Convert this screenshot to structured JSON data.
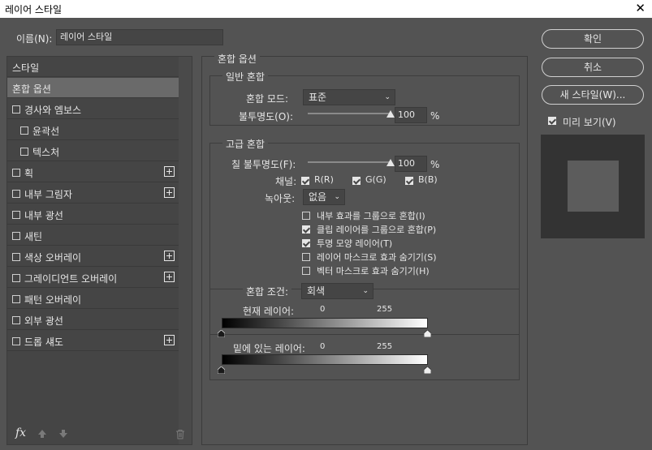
{
  "window": {
    "title": "레이어 스타일",
    "close_label": "✕"
  },
  "name_field": {
    "label": "이름(N):",
    "value": "레이어 스타일"
  },
  "styles_list": [
    {
      "label": "스타일",
      "checkbox": false,
      "checked": false,
      "plus": false,
      "selected": false,
      "indent": false
    },
    {
      "label": "혼합 옵션",
      "checkbox": false,
      "checked": false,
      "plus": false,
      "selected": true,
      "indent": false
    },
    {
      "label": "경사와 엠보스",
      "checkbox": true,
      "checked": false,
      "plus": false,
      "selected": false,
      "indent": false
    },
    {
      "label": "윤곽선",
      "checkbox": true,
      "checked": false,
      "plus": false,
      "selected": false,
      "indent": true
    },
    {
      "label": "텍스처",
      "checkbox": true,
      "checked": false,
      "plus": false,
      "selected": false,
      "indent": true
    },
    {
      "label": "획",
      "checkbox": true,
      "checked": false,
      "plus": true,
      "selected": false,
      "indent": false
    },
    {
      "label": "내부 그림자",
      "checkbox": true,
      "checked": false,
      "plus": true,
      "selected": false,
      "indent": false
    },
    {
      "label": "내부 광선",
      "checkbox": true,
      "checked": false,
      "plus": false,
      "selected": false,
      "indent": false
    },
    {
      "label": "새틴",
      "checkbox": true,
      "checked": false,
      "plus": false,
      "selected": false,
      "indent": false
    },
    {
      "label": "색상 오버레이",
      "checkbox": true,
      "checked": false,
      "plus": true,
      "selected": false,
      "indent": false
    },
    {
      "label": "그레이디언트 오버레이",
      "checkbox": true,
      "checked": false,
      "plus": true,
      "selected": false,
      "indent": false
    },
    {
      "label": "패턴 오버레이",
      "checkbox": true,
      "checked": false,
      "plus": false,
      "selected": false,
      "indent": false
    },
    {
      "label": "외부 광선",
      "checkbox": true,
      "checked": false,
      "plus": false,
      "selected": false,
      "indent": false
    },
    {
      "label": "드롭 섀도",
      "checkbox": true,
      "checked": false,
      "plus": true,
      "selected": false,
      "indent": false
    }
  ],
  "list_footer": {
    "fx_label": "fx",
    "up_icon": "arrow-up-icon",
    "down_icon": "arrow-down-icon",
    "trash_icon": "trash-icon"
  },
  "blend_options": {
    "title": "혼합 옵션",
    "general": {
      "title": "일반 혼합",
      "mode_label": "혼합 모드:",
      "mode_value": "표준",
      "opacity_label": "불투명도(O):",
      "opacity_value": "100",
      "opacity_fraction": 1.0,
      "unit": "%"
    },
    "advanced": {
      "title": "고급 혼합",
      "fill_label": "칠 불투명도(F):",
      "fill_value": "100",
      "fill_fraction": 1.0,
      "unit": "%",
      "channels_label": "채널:",
      "channels": [
        {
          "label": "R(R)",
          "checked": true
        },
        {
          "label": "G(G)",
          "checked": true
        },
        {
          "label": "B(B)",
          "checked": true
        }
      ],
      "knockout_label": "녹아웃:",
      "knockout_value": "없음",
      "options": [
        {
          "label": "내부 효과를 그룹으로 혼합(I)",
          "checked": false
        },
        {
          "label": "클립 레이어를 그룹으로 혼합(P)",
          "checked": true
        },
        {
          "label": "투명 모양 레이어(T)",
          "checked": true
        },
        {
          "label": "레이어 마스크로 효과 숨기기(S)",
          "checked": false
        },
        {
          "label": "벡터 마스크로 효과 숨기기(H)",
          "checked": false
        }
      ]
    },
    "blend_if": {
      "label": "혼합 조건:",
      "value": "회색",
      "this_layer": {
        "label": "현재 레이어:",
        "min": "0",
        "max": "255"
      },
      "underlying_layer": {
        "label": "밑에 있는 레이어:",
        "min": "0",
        "max": "255"
      }
    }
  },
  "buttons": {
    "ok": "확인",
    "cancel": "취소",
    "new_style": "새 스타일(W)..."
  },
  "preview": {
    "label": "미리 보기(V)",
    "checked": true
  }
}
